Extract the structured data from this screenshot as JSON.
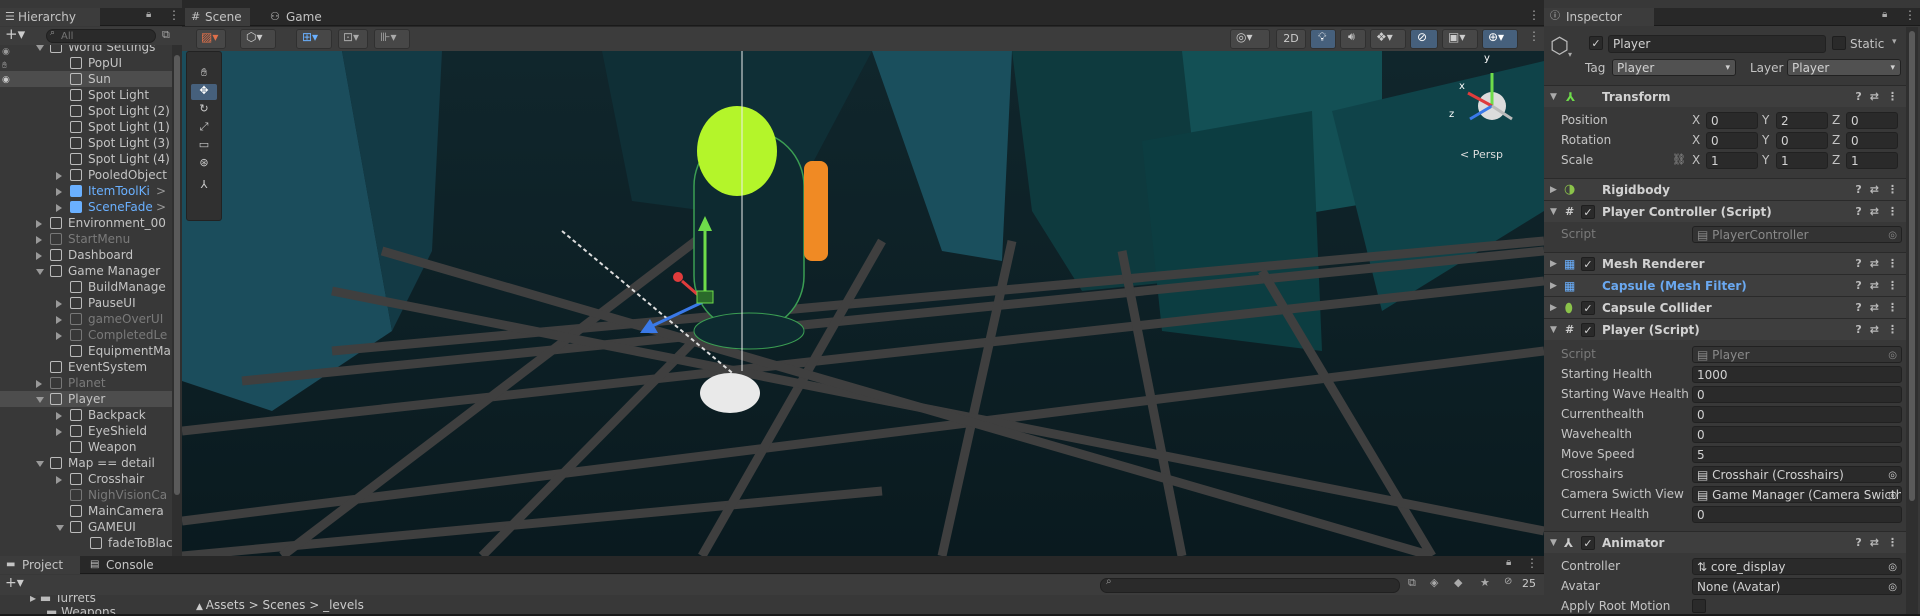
{
  "hierarchy": {
    "tab": "Hierarchy",
    "search_placeholder": "All",
    "items": [
      {
        "label": "World Settings",
        "cls": ""
      },
      {
        "label": "PopUI",
        "cls": ""
      },
      {
        "label": "Sun",
        "cls": ""
      },
      {
        "label": "Spot Light",
        "cls": ""
      },
      {
        "label": "Spot Light (2)",
        "cls": ""
      },
      {
        "label": "Spot Light (1)",
        "cls": ""
      },
      {
        "label": "Spot Light (3)",
        "cls": ""
      },
      {
        "label": "Spot Light (4)",
        "cls": ""
      },
      {
        "label": "PooledObject",
        "cls": ""
      },
      {
        "label": "ItemToolKi",
        "cls": "blue"
      },
      {
        "label": "SceneFade",
        "cls": "blue"
      },
      {
        "label": "Environment_00",
        "cls": ""
      },
      {
        "label": "StartMenu",
        "cls": "dim"
      },
      {
        "label": "Dashboard",
        "cls": ""
      },
      {
        "label": "Game Manager",
        "cls": ""
      },
      {
        "label": "BuildManage",
        "cls": ""
      },
      {
        "label": "PauseUI",
        "cls": ""
      },
      {
        "label": "gameOverUI",
        "cls": "dim"
      },
      {
        "label": "CompletedLe",
        "cls": "dim"
      },
      {
        "label": "EquipmentMa",
        "cls": ""
      },
      {
        "label": "EventSystem",
        "cls": ""
      },
      {
        "label": "Planet",
        "cls": "dim"
      },
      {
        "label": "Player",
        "cls": ""
      },
      {
        "label": "Backpack",
        "cls": ""
      },
      {
        "label": "EyeShield",
        "cls": ""
      },
      {
        "label": "Weapon",
        "cls": ""
      },
      {
        "label": "Map == detail",
        "cls": ""
      },
      {
        "label": "Crosshair",
        "cls": ""
      },
      {
        "label": "NighVisionCa",
        "cls": "dim"
      },
      {
        "label": "MainCamera",
        "cls": ""
      },
      {
        "label": "GAMEUI",
        "cls": ""
      },
      {
        "label": "fadeToBlac",
        "cls": ""
      }
    ]
  },
  "scene": {
    "tabs": [
      "Scene",
      "Game"
    ],
    "mode_2d": "2D",
    "persp_label": "< Persp",
    "axis_x": "x",
    "axis_y": "y",
    "axis_z": "z"
  },
  "project": {
    "tabs": [
      "Project",
      "Console"
    ],
    "breadcrumb": [
      "Assets",
      "Scenes",
      "_levels"
    ],
    "folders": [
      "Turrets",
      "Weapons"
    ],
    "badge_count": "25"
  },
  "inspector": {
    "tab": "Inspector",
    "object_name": "Player",
    "static_label": "Static",
    "tag_label": "Tag",
    "tag_value": "Player",
    "layer_label": "Layer",
    "layer_value": "Player",
    "transform": {
      "title": "Transform",
      "position_label": "Position",
      "rotation_label": "Rotation",
      "scale_label": "Scale",
      "x": "X",
      "y": "Y",
      "z": "Z",
      "position": [
        "0",
        "2",
        "0"
      ],
      "rotation": [
        "0",
        "0",
        "0"
      ],
      "scale": [
        "1",
        "1",
        "1"
      ]
    },
    "rigidbody": "Rigidbody",
    "player_controller": {
      "title": "Player Controller (Script)",
      "script_label": "Script",
      "script_value": "PlayerController"
    },
    "mesh_renderer": "Mesh Renderer",
    "mesh_filter": "Capsule (Mesh Filter)",
    "capsule_collider": "Capsule Collider",
    "player_script": {
      "title": "Player (Script)",
      "fields": [
        {
          "label": "Script",
          "value": "Player"
        },
        {
          "label": "Starting Health",
          "value": "1000"
        },
        {
          "label": "Starting Wave Health",
          "value": "0"
        },
        {
          "label": "Currenthealth",
          "value": "0"
        },
        {
          "label": "Wavehealth",
          "value": "0"
        },
        {
          "label": "Move Speed",
          "value": "5"
        },
        {
          "label": "Crosshairs",
          "value": "Crosshair (Crosshairs)"
        },
        {
          "label": "Camera Swicth View",
          "value": "Game Manager (Camera Swicth"
        },
        {
          "label": "Current Health",
          "value": "0"
        }
      ]
    },
    "animator": {
      "title": "Animator",
      "controller_label": "Controller",
      "controller_value": "core_display",
      "avatar_label": "Avatar",
      "avatar_value": "None (Avatar)",
      "root_motion_label": "Apply Root Motion"
    }
  }
}
